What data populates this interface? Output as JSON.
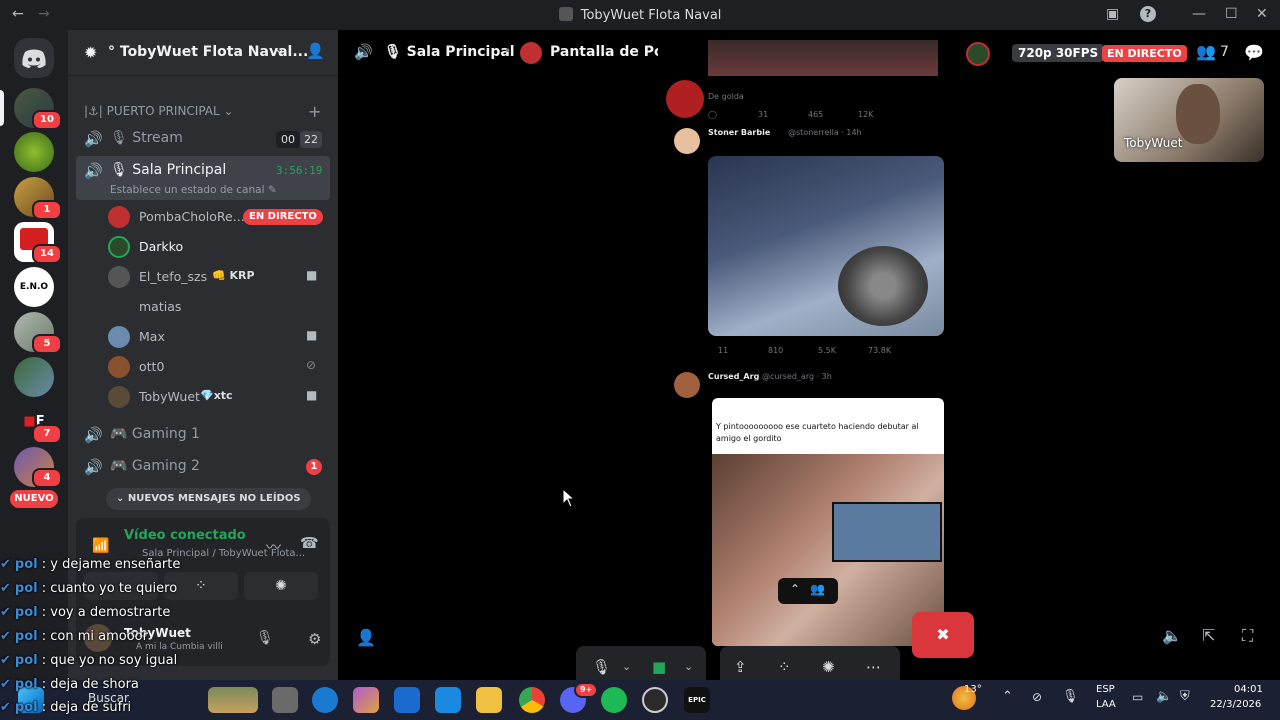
{
  "window": {
    "title": "TobyWuet Flota Naval"
  },
  "guilds": {
    "badges": [
      "10",
      "1",
      "14",
      "5",
      "7",
      "4"
    ],
    "new_label": "NUEVO",
    "eno_label": "E.N.O"
  },
  "sidebar": {
    "server_name": "TobyWuet Flota Naval",
    "category": "PUERTO PRINCIPAL",
    "channels": {
      "stream": {
        "name": "Stream",
        "count_a": "00",
        "count_b": "22"
      },
      "sala": {
        "name": "Sala Principal",
        "timer": "3:56:19",
        "status": "Establece un estado de canal"
      },
      "gaming1": {
        "name": "Gaming 1"
      },
      "gaming2": {
        "name": "Gaming 2",
        "badge": "1"
      }
    },
    "users": [
      {
        "name": "PombaCholoRe...",
        "tag": "EN DIRECTO"
      },
      {
        "name": "Darkko"
      },
      {
        "name": "El_tefo_szs",
        "tag": "KRP"
      },
      {
        "name": "matias"
      },
      {
        "name": "Max"
      },
      {
        "name": "ott0"
      },
      {
        "name": "TobyWuet",
        "tag": "xtc"
      }
    ],
    "new_messages": "NUEVOS MENSAJES NO LEÍDOS",
    "voice": {
      "status": "Vídeo conectado",
      "channel": "Sala Principal / TobyWuet Flota..."
    },
    "user_panel": {
      "name": "TobyWuet",
      "status": "A mi la Cumbia villi"
    }
  },
  "topbar": {
    "channel": "Sala Principal",
    "screen": "Pantalla de PombaCholoReal",
    "quality": "720p 30FPS",
    "live": "EN DIRECTO",
    "viewers": "7"
  },
  "stream": {
    "tweet1": {
      "name": "Stoner Barbie",
      "handle": "@stonerrella · 14h",
      "stats": [
        "11",
        "810",
        "5.5K",
        "73.8K"
      ]
    },
    "tweet2": {
      "name": "Cursed_Arg",
      "handle": "@cursed_arg · 3h",
      "text1": "Y pintooooooooo ese cuarteto haciendo debutar al",
      "text2": "amigo el gordito"
    },
    "top_stats": [
      "31",
      "465",
      "12K"
    ],
    "top_text": "De golda"
  },
  "pip": {
    "name": "TobyWuet"
  },
  "chat": [
    {
      "user": "pol",
      "msg": "y dejame enseñarte"
    },
    {
      "user": "pol",
      "msg": "cuanto yo te quiero"
    },
    {
      "user": "pol",
      "msg": "voy a demostrarte"
    },
    {
      "user": "pol",
      "msg": "con mi amooor"
    },
    {
      "user": "pol",
      "msg": "que yo no soy igual"
    },
    {
      "user": "pol",
      "msg": "deja de shora"
    },
    {
      "user": "pol",
      "msg": "deja de sufri"
    }
  ],
  "taskbar": {
    "search": "Buscar",
    "weather": "13°",
    "lang1": "ESP",
    "lang2": "LAA",
    "time": "04:01",
    "date": "22/3/2026",
    "discord_badge": "9+"
  },
  "colors": {
    "accent": "#5865f2",
    "live": "#ed4245",
    "green": "#23a55a",
    "danger": "#da373c"
  }
}
